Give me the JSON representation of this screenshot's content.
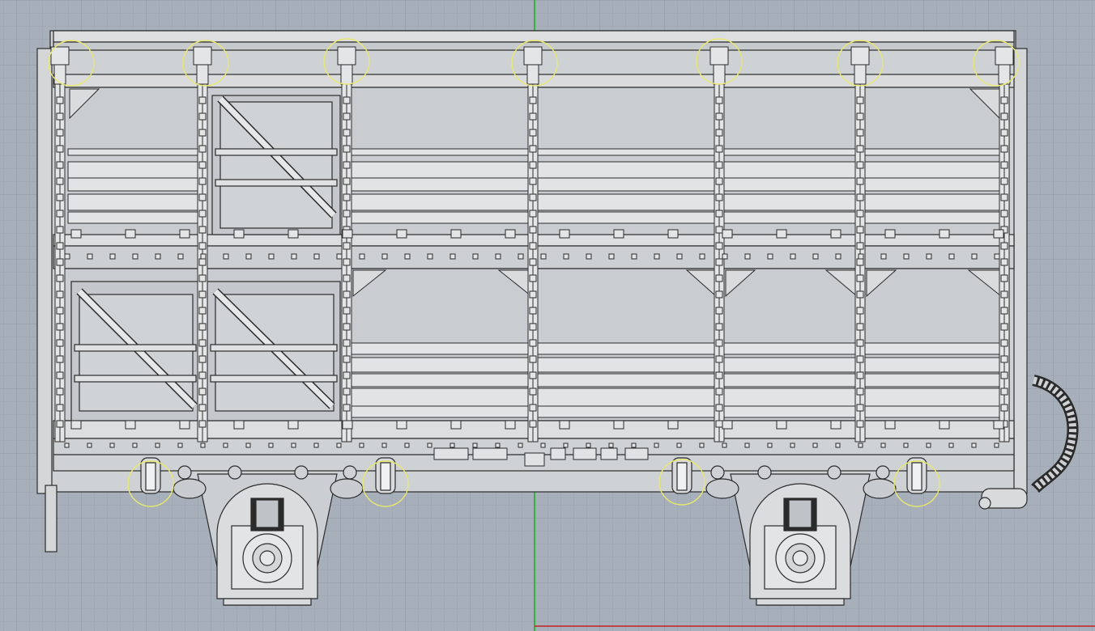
{
  "viewport": {
    "background": "#a7b0ba",
    "grid_minor": "#9ba4ae",
    "grid_major": "#8f98a2",
    "axis_y_color": "#13b013",
    "axis_x_color": "#c02020"
  },
  "drawing": {
    "line_color": "#2b2b2b",
    "fill_color": "#d4d6d8",
    "panel_fill": "#c8cbcf",
    "highlight_color": "#e8e870"
  },
  "highlight_markers": {
    "count": 11,
    "description_hidden": true
  }
}
